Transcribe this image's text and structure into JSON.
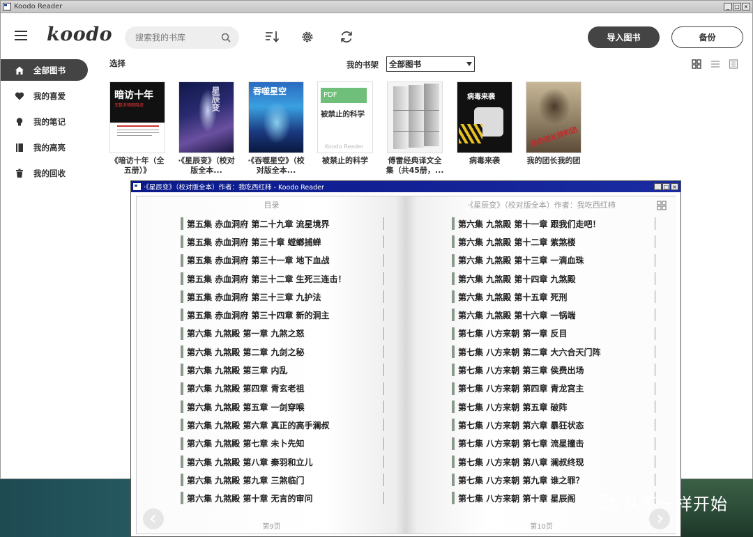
{
  "main_window": {
    "title": "Koodo Reader",
    "controls": [
      "_",
      "□",
      "×"
    ]
  },
  "header": {
    "logo": "koodo",
    "search": {
      "placeholder": "搜索我的书库"
    },
    "import_button": "导入图书",
    "backup_button": "备份"
  },
  "sidebar": {
    "items": [
      {
        "label": "全部图书",
        "icon": "home-icon",
        "active": true
      },
      {
        "label": "我的喜爱",
        "icon": "heart-icon",
        "active": false
      },
      {
        "label": "我的笔记",
        "icon": "bulb-icon",
        "active": false
      },
      {
        "label": "我的高亮",
        "icon": "highlight-book-icon",
        "active": false
      },
      {
        "label": "我的回收",
        "icon": "trash-icon",
        "active": false
      }
    ]
  },
  "toolbar": {
    "select_label": "选择",
    "shelf_label": "我的书架",
    "shelf_value": "全部图书"
  },
  "books": [
    {
      "title": "《暗访十年（全五册）》",
      "cover_text": "暗访十年",
      "cover_sub": "无数来明暗隐迹",
      "colors": [
        "#ffffff",
        "#111111"
      ]
    },
    {
      "title": "·《星辰变》（校对版全本...",
      "cover_text": "星辰变",
      "colors": [
        "#1a2a66",
        "#6a4a9a"
      ]
    },
    {
      "title": "·《吞噬星空》（校对版全本...",
      "cover_text": "吞噬星空",
      "colors": [
        "#1a4aa0",
        "#3aa0d0"
      ]
    },
    {
      "title": "被禁止的科学",
      "cover_text": "被禁止的科学",
      "cover_badge": "PDF",
      "cover_footer": "Koodo Reader",
      "colors": [
        "#6fbf7a",
        "#ffffff"
      ]
    },
    {
      "title": "傅雷经典译文全集（共45册，...",
      "cover_text": "",
      "colors": [
        "#cfcfcf",
        "#9a9a9a"
      ]
    },
    {
      "title": "病毒来袭",
      "cover_text": "病毒来袭",
      "colors": [
        "#1a1a1a",
        "#e0c020"
      ]
    },
    {
      "title": "我的团长我的团",
      "cover_text": "我的团长我的团",
      "colors": [
        "#9a8a70",
        "#c03030"
      ]
    }
  ],
  "reader": {
    "title": "·《星辰变》（校对版全本）作者：我吃西红柿 - Koodo Reader",
    "left_header": "目录",
    "right_header": "·《星辰变》（校对版全本）作者：我吃西红柿",
    "left_footer": "第9页",
    "right_footer": "第10页",
    "left_toc": [
      "第五集 赤血洞府 第二十九章 流星境界",
      "第五集 赤血洞府 第三十章 螳螂捕蝉",
      "第五集 赤血洞府 第三十一章 地下血战",
      "第五集 赤血洞府 第三十二章 生死三连击！",
      "第五集 赤血洞府 第三十三章 九护法",
      "第五集 赤血洞府 第三十四章 新的洞主",
      "第六集 九煞殿 第一章 九煞之怒",
      "第六集 九煞殿 第二章 九剑之秘",
      "第六集 九煞殿 第三章 内乱",
      "第六集 九煞殿 第四章 青玄老祖",
      "第六集 九煞殿 第五章 一剑穿喉",
      "第六集 九煞殿 第六章 真正的高手澜叔",
      "第六集 九煞殿 第七章 未卜先知",
      "第六集 九煞殿 第八章 秦羽和立儿",
      "第六集 九煞殿 第九章 三煞临门",
      "第六集 九煞殿 第十章 无言的审问"
    ],
    "right_toc": [
      "第六集 九煞殿 第十一章 跟我们走吧！",
      "第六集 九煞殿 第十二章 紫煞楼",
      "第六集 九煞殿 第十三章 一滴血珠",
      "第六集 九煞殿 第十四章 九煞殿",
      "第六集 九煞殿 第十五章 死刑",
      "第六集 九煞殿 第十六章 一锅端",
      "第七集 八方来朝 第一章 反目",
      "第七集 八方来朝 第二章 大六合天门阵",
      "第七集 八方来朝 第三章 侯费出场",
      "第七集 八方来朝 第四章 青龙宫主",
      "第七集 八方来朝 第五章 破阵",
      "第七集 八方来朝 第六章 暴狂状态",
      "第七集 八方来朝 第七章 流星撞击",
      "第七集 八方来朝 第八章 澜叔终现",
      "第七集 八方来朝 第九章 谁之罪？",
      "第七集 八方来朝 第十章 星辰阁"
    ]
  },
  "watermark": {
    "text": "从不一样开始"
  }
}
